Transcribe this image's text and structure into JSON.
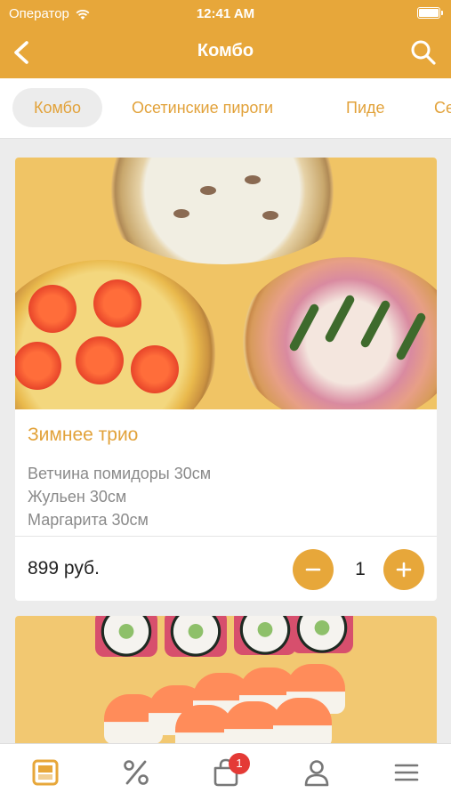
{
  "status_bar": {
    "carrier": "Оператор",
    "time": "12:41 AM"
  },
  "header": {
    "title": "Комбо"
  },
  "tabs": [
    {
      "label": "Комбо",
      "active": true
    },
    {
      "label": "Осетинские пироги",
      "active": false
    },
    {
      "label": "Пиде",
      "active": false
    },
    {
      "label": "Се",
      "active": false
    }
  ],
  "products": [
    {
      "title": "Зимнее трио",
      "description": [
        "Ветчина помидоры 30см",
        "Жульен 30см",
        "Маргарита 30см"
      ],
      "price": "899 руб.",
      "quantity": "1"
    }
  ],
  "tab_bar": {
    "items": [
      "menu-icon",
      "percent-icon",
      "cart-icon",
      "profile-icon",
      "hamburger-icon"
    ],
    "cart_badge": "1"
  },
  "colors": {
    "accent": "#e7a73a",
    "text_accent": "#e2a23a",
    "badge": "#e43a36"
  }
}
